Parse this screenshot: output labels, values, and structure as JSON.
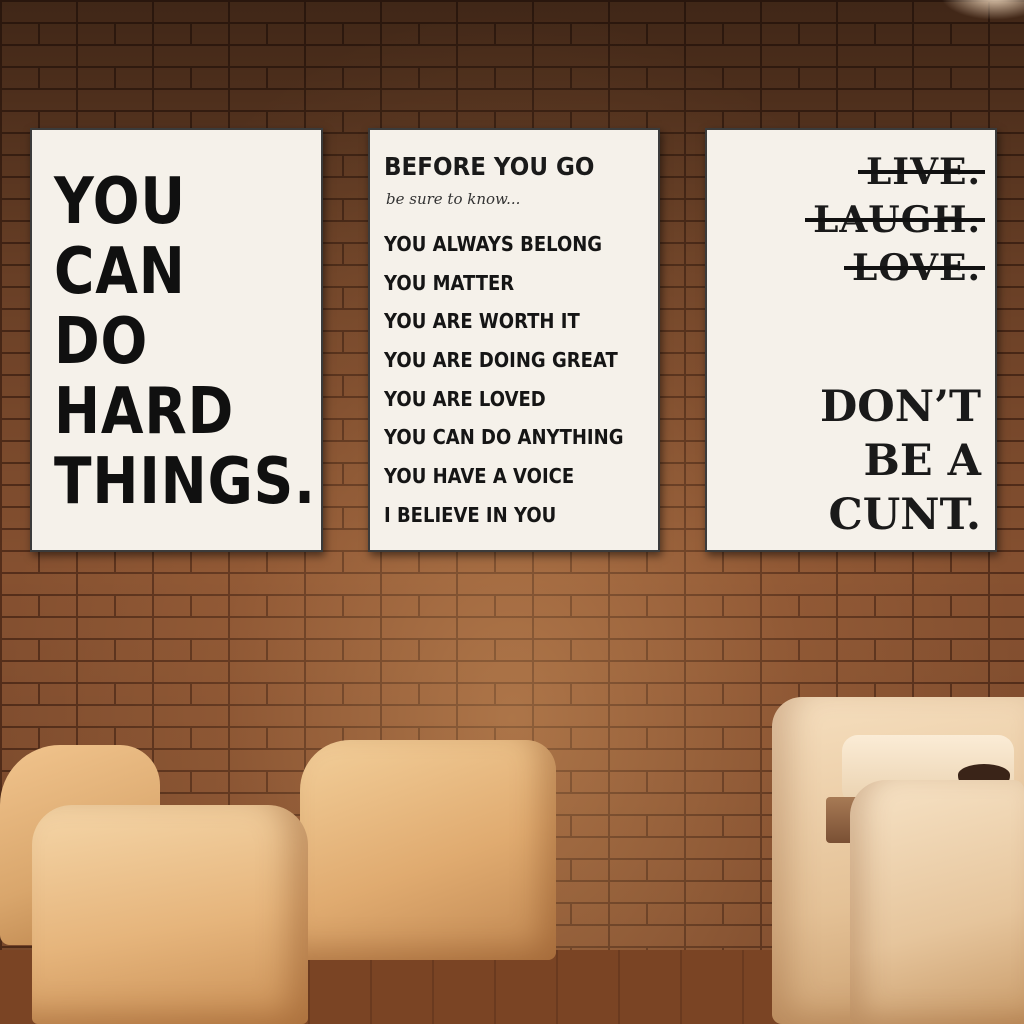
{
  "posters": {
    "left": {
      "lines": [
        "YOU",
        "CAN",
        "DO",
        "HARD",
        "THINGS."
      ]
    },
    "middle": {
      "title": "BEFORE YOU GO",
      "subtitle": "be sure to know...",
      "items": [
        "YOU ALWAYS BELONG",
        "YOU MATTER",
        "YOU ARE WORTH IT",
        "YOU ARE DOING GREAT",
        "YOU ARE LOVED",
        "YOU CAN DO ANYTHING",
        "YOU HAVE A VOICE",
        "I BELIEVE IN YOU"
      ]
    },
    "right": {
      "struck_lines": [
        "LIVE.",
        "LAUGH.",
        "LOVE."
      ],
      "bottom_lines": [
        "DON’T",
        "BE A",
        "CUNT."
      ]
    }
  },
  "colors": {
    "brick": "#8d5533",
    "poster_bg": "#f5f1ea",
    "text": "#101010",
    "chair": "#e6b57c"
  }
}
